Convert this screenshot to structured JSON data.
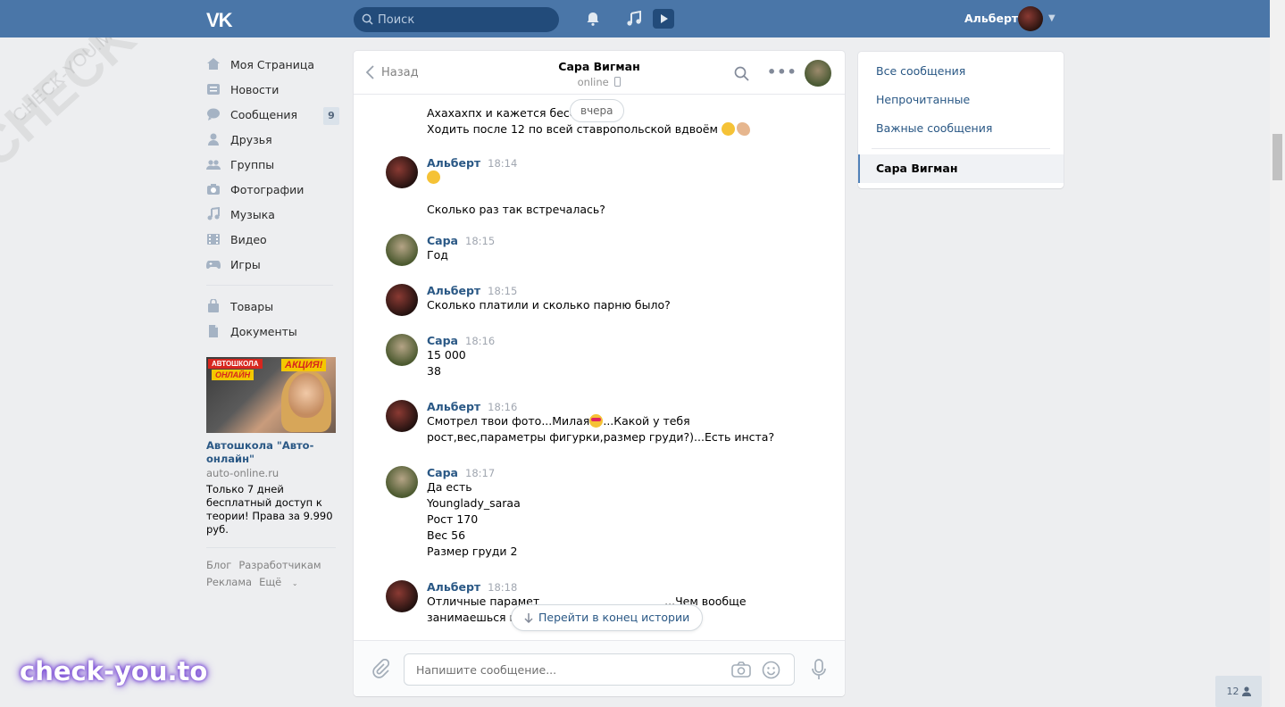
{
  "header": {
    "logo": "VK",
    "search_placeholder": "Поиск",
    "user_name": "Альберт"
  },
  "nav": {
    "items": [
      {
        "label": "Моя Страница",
        "icon": "home-icon"
      },
      {
        "label": "Новости",
        "icon": "news-icon"
      },
      {
        "label": "Сообщения",
        "icon": "messages-icon",
        "badge": "9"
      },
      {
        "label": "Друзья",
        "icon": "friends-icon"
      },
      {
        "label": "Группы",
        "icon": "groups-icon"
      },
      {
        "label": "Фотографии",
        "icon": "camera-icon"
      },
      {
        "label": "Музыка",
        "icon": "music-icon"
      },
      {
        "label": "Видео",
        "icon": "video-icon"
      },
      {
        "label": "Игры",
        "icon": "games-icon"
      }
    ],
    "items2": [
      {
        "label": "Товары",
        "icon": "bag-icon"
      },
      {
        "label": "Документы",
        "icon": "document-icon"
      }
    ]
  },
  "ad": {
    "banner_a": "АВТОШКОЛА",
    "banner_b": "АКЦИЯ!",
    "banner_c": "ОНЛАЙН",
    "title": "Автошкола \"Авто-онлайн\"",
    "domain": "auto-online.ru",
    "text": "Только 7 дней бесплатный доступ к теории! Права за 9.990 руб."
  },
  "footer": {
    "links": [
      "Блог",
      "Разработчикам",
      "Реклама",
      "Ещё"
    ]
  },
  "chat": {
    "back_label": "Назад",
    "title": "Сара Вигман",
    "status": "online",
    "date_divider": "вчера",
    "jump_label": "Перейти в конец истории",
    "input_placeholder": "Напишите сообщение...",
    "messages": [
      {
        "author": "",
        "time": "",
        "lines": [
          "Ахахахпх и кажется бесстр",
          "Ходить после 12 по всей ставропольской вдвоём"
        ]
      },
      {
        "author": "Альберт",
        "time": "18:14",
        "lines": [
          "",
          "",
          "Сколько раз так встречалась?"
        ]
      },
      {
        "author": "Сара",
        "time": "18:15",
        "lines": [
          "Год"
        ]
      },
      {
        "author": "Альберт",
        "time": "18:15",
        "lines": [
          "Сколько платили и сколько парню было?"
        ]
      },
      {
        "author": "Сара",
        "time": "18:16",
        "lines": [
          "15 000",
          "38"
        ]
      },
      {
        "author": "Альберт",
        "time": "18:16",
        "lines": [
          "Смотрел твои фото...Милая",
          "...Какой у тебя",
          "рост,вес,параметры фигурки,размер груди?)...Есть инста?"
        ]
      },
      {
        "author": "Сара",
        "time": "18:17",
        "lines": [
          "Да есть",
          "Younglady_saraa",
          "Рост 170",
          "Вес 56",
          "Размер груди 2"
        ]
      },
      {
        "author": "Альберт",
        "time": "18:18",
        "lines": [
          "Отличные парамет",
          "...Чем вообще",
          "занимаешься в"
        ]
      }
    ]
  },
  "right_menu": {
    "all": "Все сообщения",
    "unread": "Непрочитанные",
    "important": "Важные сообщения",
    "active": "Сара Вигман"
  },
  "overlay": {
    "brand": "check-you.to",
    "watermark": "CHECK-YOU.ME",
    "watermark_small": "CHECK-YOU.ME",
    "online_count": "12"
  },
  "colors": {
    "header_bg": "#4a76a8",
    "link": "#2a5885",
    "page_bg": "#edeef0"
  }
}
